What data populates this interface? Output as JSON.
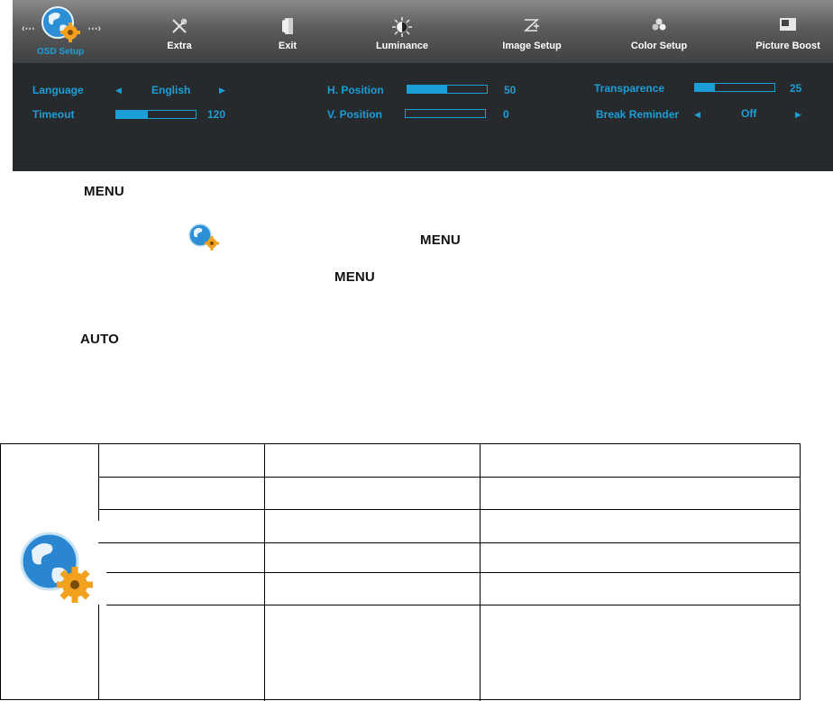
{
  "osd": {
    "tabs": [
      {
        "id": "osd-setup",
        "label": "OSD Setup",
        "icon": "globe-gear-icon",
        "active": true
      },
      {
        "id": "extra",
        "label": "Extra",
        "icon": "tools-icon"
      },
      {
        "id": "exit",
        "label": "Exit",
        "icon": "exit-door-icon"
      },
      {
        "id": "luminance",
        "label": "Luminance",
        "icon": "sun-icon"
      },
      {
        "id": "image-setup",
        "label": "Image Setup",
        "icon": "image-setup-icon"
      },
      {
        "id": "color-setup",
        "label": "Color Setup",
        "icon": "color-circles-icon"
      },
      {
        "id": "picture-boost",
        "label": "Picture Boost",
        "icon": "picture-boost-icon"
      }
    ],
    "settings": {
      "language": {
        "label": "Language",
        "value": "English"
      },
      "timeout": {
        "label": "Timeout",
        "value": "120",
        "level": 0.4
      },
      "h_position": {
        "label": "H. Position",
        "value": "50",
        "level": 0.5
      },
      "v_position": {
        "label": "V. Position",
        "value": "0",
        "level": 0
      },
      "transparence": {
        "label": "Transparence",
        "value": "25",
        "level": 0.25
      },
      "break_reminder": {
        "label": "Break Reminder",
        "value": "Off"
      }
    },
    "accent_color": "#1c9ed8"
  },
  "instructions": {
    "line1_key": "MENU",
    "line2_key": "MENU",
    "line3_key": "MENU",
    "line4_key": "AUTO"
  },
  "table": {
    "icon": "globe-gear-icon",
    "rows": [
      [
        "",
        "",
        ""
      ],
      [
        "",
        "",
        ""
      ],
      [
        "",
        "",
        ""
      ],
      [
        "",
        "",
        ""
      ],
      [
        "",
        "",
        ""
      ],
      [
        "",
        "",
        ""
      ]
    ]
  }
}
